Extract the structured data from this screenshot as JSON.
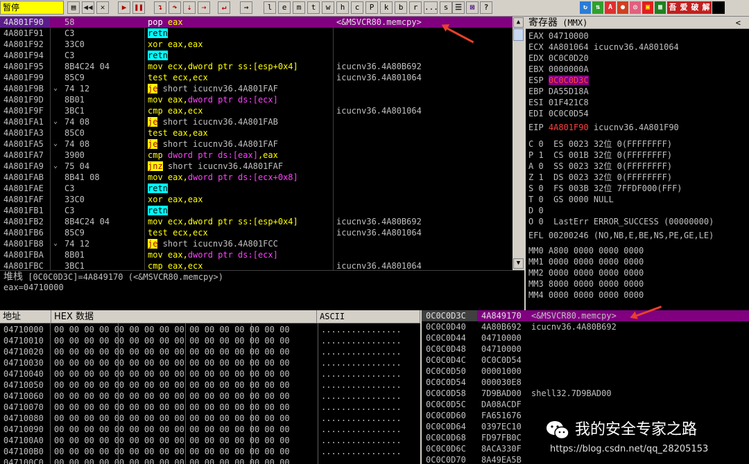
{
  "toolbar": {
    "status": "暂停",
    "letters": [
      "l",
      "e",
      "m",
      "t",
      "w",
      "h",
      "c",
      "P",
      "k",
      "b",
      "r",
      "...",
      "s"
    ],
    "color_buttons": [
      "A",
      "吾",
      "爱",
      "破",
      "解"
    ]
  },
  "disasm": {
    "rows": [
      {
        "addr": "4A801F90",
        "hex": "58",
        "jmark": "",
        "parts": [
          {
            "t": "pop",
            "c": "kw-blue"
          },
          {
            "t": " eax",
            "c": "reg"
          }
        ],
        "comment": "<&MSVCR80.memcpy>",
        "sel": true
      },
      {
        "addr": "4A801F91",
        "hex": "C3",
        "jmark": "",
        "parts": [
          {
            "t": "retn",
            "c": "retn"
          }
        ],
        "comment": ""
      },
      {
        "addr": "4A801F92",
        "hex": "33C0",
        "jmark": "",
        "parts": [
          {
            "t": "xor ",
            "c": "reg"
          },
          {
            "t": "eax,eax",
            "c": "reg"
          }
        ],
        "comment": ""
      },
      {
        "addr": "4A801F94",
        "hex": "C3",
        "jmark": "",
        "parts": [
          {
            "t": "retn",
            "c": "retn"
          }
        ],
        "comment": ""
      },
      {
        "addr": "4A801F95",
        "hex": "8B4C24 04",
        "jmark": "",
        "parts": [
          {
            "t": "mov ",
            "c": "reg"
          },
          {
            "t": "ecx,",
            "c": "reg"
          },
          {
            "t": "dword ptr ss:[esp+0x4]",
            "c": "reg"
          }
        ],
        "comment": "icucnv36.4A80B692"
      },
      {
        "addr": "4A801F99",
        "hex": "85C9",
        "jmark": "",
        "parts": [
          {
            "t": "test ",
            "c": "reg"
          },
          {
            "t": "ecx,ecx",
            "c": "reg"
          }
        ],
        "comment": "icucnv36.4A801064"
      },
      {
        "addr": "4A801F9B",
        "hex": "74 12",
        "jmark": "⌄",
        "parts": [
          {
            "t": "je",
            "c": "jmp"
          },
          {
            "t": " short icucnv36.4A801FAF",
            "c": "kw-white"
          }
        ],
        "comment": ""
      },
      {
        "addr": "4A801F9D",
        "hex": "8B01",
        "jmark": "",
        "parts": [
          {
            "t": "mov ",
            "c": "reg"
          },
          {
            "t": "eax,",
            "c": "reg"
          },
          {
            "t": "dword ptr ds:[ecx]",
            "c": "ptr"
          }
        ],
        "comment": ""
      },
      {
        "addr": "4A801F9F",
        "hex": "3BC1",
        "jmark": "",
        "parts": [
          {
            "t": "cmp ",
            "c": "reg"
          },
          {
            "t": "eax,ecx",
            "c": "reg"
          }
        ],
        "comment": "icucnv36.4A801064"
      },
      {
        "addr": "4A801FA1",
        "hex": "74 08",
        "jmark": "⌄",
        "parts": [
          {
            "t": "je",
            "c": "jmp"
          },
          {
            "t": " short icucnv36.4A801FAB",
            "c": "kw-white"
          }
        ],
        "comment": ""
      },
      {
        "addr": "4A801FA3",
        "hex": "85C0",
        "jmark": "",
        "parts": [
          {
            "t": "test ",
            "c": "reg"
          },
          {
            "t": "eax,eax",
            "c": "reg"
          }
        ],
        "comment": ""
      },
      {
        "addr": "4A801FA5",
        "hex": "74 08",
        "jmark": "⌄",
        "parts": [
          {
            "t": "je",
            "c": "jmp"
          },
          {
            "t": " short icucnv36.4A801FAF",
            "c": "kw-white"
          }
        ],
        "comment": ""
      },
      {
        "addr": "4A801FA7",
        "hex": "3900",
        "jmark": "",
        "parts": [
          {
            "t": "cmp ",
            "c": "reg"
          },
          {
            "t": "dword ptr ds:[eax]",
            "c": "ptr"
          },
          {
            "t": ",eax",
            "c": "reg"
          }
        ],
        "comment": ""
      },
      {
        "addr": "4A801FA9",
        "hex": "75 04",
        "jmark": "⌄",
        "parts": [
          {
            "t": "jnz",
            "c": "jmp"
          },
          {
            "t": " short icucnv36.4A801FAF",
            "c": "kw-white"
          }
        ],
        "comment": ""
      },
      {
        "addr": "4A801FAB",
        "hex": "8B41 08",
        "jmark": "",
        "parts": [
          {
            "t": "mov ",
            "c": "reg"
          },
          {
            "t": "eax,",
            "c": "reg"
          },
          {
            "t": "dword ptr ds:[ecx+0x8]",
            "c": "ptr"
          }
        ],
        "comment": ""
      },
      {
        "addr": "4A801FAE",
        "hex": "C3",
        "jmark": "",
        "parts": [
          {
            "t": "retn",
            "c": "retn"
          }
        ],
        "comment": ""
      },
      {
        "addr": "4A801FAF",
        "hex": "33C0",
        "jmark": "",
        "parts": [
          {
            "t": "xor ",
            "c": "reg"
          },
          {
            "t": "eax,eax",
            "c": "reg"
          }
        ],
        "comment": ""
      },
      {
        "addr": "4A801FB1",
        "hex": "C3",
        "jmark": "",
        "parts": [
          {
            "t": "retn",
            "c": "retn"
          }
        ],
        "comment": ""
      },
      {
        "addr": "4A801FB2",
        "hex": "8B4C24 04",
        "jmark": "",
        "parts": [
          {
            "t": "mov ",
            "c": "reg"
          },
          {
            "t": "ecx,",
            "c": "reg"
          },
          {
            "t": "dword ptr ss:[esp+0x4]",
            "c": "reg"
          }
        ],
        "comment": "icucnv36.4A80B692"
      },
      {
        "addr": "4A801FB6",
        "hex": "85C9",
        "jmark": "",
        "parts": [
          {
            "t": "test ",
            "c": "reg"
          },
          {
            "t": "ecx,ecx",
            "c": "reg"
          }
        ],
        "comment": "icucnv36.4A801064"
      },
      {
        "addr": "4A801FB8",
        "hex": "74 12",
        "jmark": "⌄",
        "parts": [
          {
            "t": "je",
            "c": "jmp"
          },
          {
            "t": " short icucnv36.4A801FCC",
            "c": "kw-white"
          }
        ],
        "comment": ""
      },
      {
        "addr": "4A801FBA",
        "hex": "8B01",
        "jmark": "",
        "parts": [
          {
            "t": "mov ",
            "c": "reg"
          },
          {
            "t": "eax,",
            "c": "reg"
          },
          {
            "t": "dword ptr ds:[ecx]",
            "c": "ptr"
          }
        ],
        "comment": ""
      },
      {
        "addr": "4A801FBC",
        "hex": "3BC1",
        "jmark": "",
        "parts": [
          {
            "t": "cmp ",
            "c": "reg"
          },
          {
            "t": "eax,ecx",
            "c": "reg"
          }
        ],
        "comment": "icucnv36.4A801064"
      }
    ]
  },
  "info": {
    "label": "堆栈",
    "line1": "[0C0C0D3C]=4A849170 (<&MSVCR80.memcpy>)",
    "line2": "eax=04710000"
  },
  "registers": {
    "title": "寄存器",
    "mode": "(MMX)",
    "collapse": "<",
    "gp": [
      {
        "name": "EAX",
        "value": "04710000",
        "comment": ""
      },
      {
        "name": "ECX",
        "value": "4A801064",
        "comment": "icucnv36.4A801064"
      },
      {
        "name": "EDX",
        "value": "0C0C0D20",
        "comment": ""
      },
      {
        "name": "EBX",
        "value": "0000000A",
        "comment": ""
      },
      {
        "name": "ESP",
        "value": "0C0C0D3C",
        "comment": "",
        "hl": true
      },
      {
        "name": "EBP",
        "value": "DA55D18A",
        "comment": ""
      },
      {
        "name": "ESI",
        "value": "01F421C8",
        "comment": ""
      },
      {
        "name": "EDI",
        "value": "0C0C0D54",
        "comment": ""
      }
    ],
    "eip": {
      "name": "EIP",
      "value": "4A801F90",
      "comment": "icucnv36.4A801F90"
    },
    "flags": [
      "C 0  ES 0023 32位 0(FFFFFFFF)",
      "P 1  CS 001B 32位 0(FFFFFFFF)",
      "A 0  SS 0023 32位 0(FFFFFFFF)",
      "Z 1  DS 0023 32位 0(FFFFFFFF)",
      "S 0  FS 003B 32位 7FFDF000(FFF)",
      "T 0  GS 0000 NULL",
      "D 0",
      "O 0  LastErr ERROR_SUCCESS (00000000)"
    ],
    "efl": "EFL 00200246 (NO,NB,E,BE,NS,PE,GE,LE)",
    "mmx": [
      "MM0 A800 0000 0000 0000",
      "MM1 0000 0000 0000 0000",
      "MM2 0000 0000 0000 0000",
      "MM3 8000 0000 0000 0000",
      "MM4 0000 0000 0000 0000"
    ]
  },
  "dump": {
    "headers": {
      "addr": "地址",
      "hex": "HEX 数据",
      "ascii": "ASCII"
    },
    "rows": [
      {
        "addr": "04710000"
      },
      {
        "addr": "04710010"
      },
      {
        "addr": "04710020"
      },
      {
        "addr": "04710030"
      },
      {
        "addr": "04710040"
      },
      {
        "addr": "04710050"
      },
      {
        "addr": "04710060"
      },
      {
        "addr": "04710070"
      },
      {
        "addr": "04710080"
      },
      {
        "addr": "04710090"
      },
      {
        "addr": "047100A0"
      },
      {
        "addr": "047100B0"
      },
      {
        "addr": "047100C0"
      }
    ],
    "hex_line": "00 00 00 00 00 00 00 00 00 00 00 00 00 00 00 00",
    "ascii_line": "................"
  },
  "stack": {
    "rows": [
      {
        "addr": "0C0C0D3C",
        "value": "4A849170",
        "comment": "<&MSVCR80.memcpy>",
        "top": true
      },
      {
        "addr": "0C0C0D40",
        "value": "4A80B692",
        "comment": "icucnv36.4A80B692"
      },
      {
        "addr": "0C0C0D44",
        "value": "04710000",
        "comment": ""
      },
      {
        "addr": "0C0C0D48",
        "value": "04710000",
        "comment": ""
      },
      {
        "addr": "0C0C0D4C",
        "value": "0C0C0D54",
        "comment": ""
      },
      {
        "addr": "0C0C0D50",
        "value": "00001000",
        "comment": ""
      },
      {
        "addr": "0C0C0D54",
        "value": "000030E8",
        "comment": ""
      },
      {
        "addr": "0C0C0D58",
        "value": "7D9BAD00",
        "comment": "shell32.7D9BAD00"
      },
      {
        "addr": "0C0C0D5C",
        "value": "DA08ACDF",
        "comment": ""
      },
      {
        "addr": "0C0C0D60",
        "value": "FA651676",
        "comment": ""
      },
      {
        "addr": "0C0C0D64",
        "value": "0397EC10",
        "comment": ""
      },
      {
        "addr": "0C0C0D68",
        "value": "FD97FB0C",
        "comment": ""
      },
      {
        "addr": "0C0C0D6C",
        "value": "8ACA330F",
        "comment": ""
      },
      {
        "addr": "0C0C0D70",
        "value": "8A49EA5B",
        "comment": ""
      }
    ]
  },
  "watermark": {
    "text": "我的安全专家之路",
    "url": "https://blog.csdn.net/qq_28205153"
  },
  "colors": {
    "accent": "#800080",
    "highlight": "#ffff00",
    "arrow": "#e8402a"
  }
}
